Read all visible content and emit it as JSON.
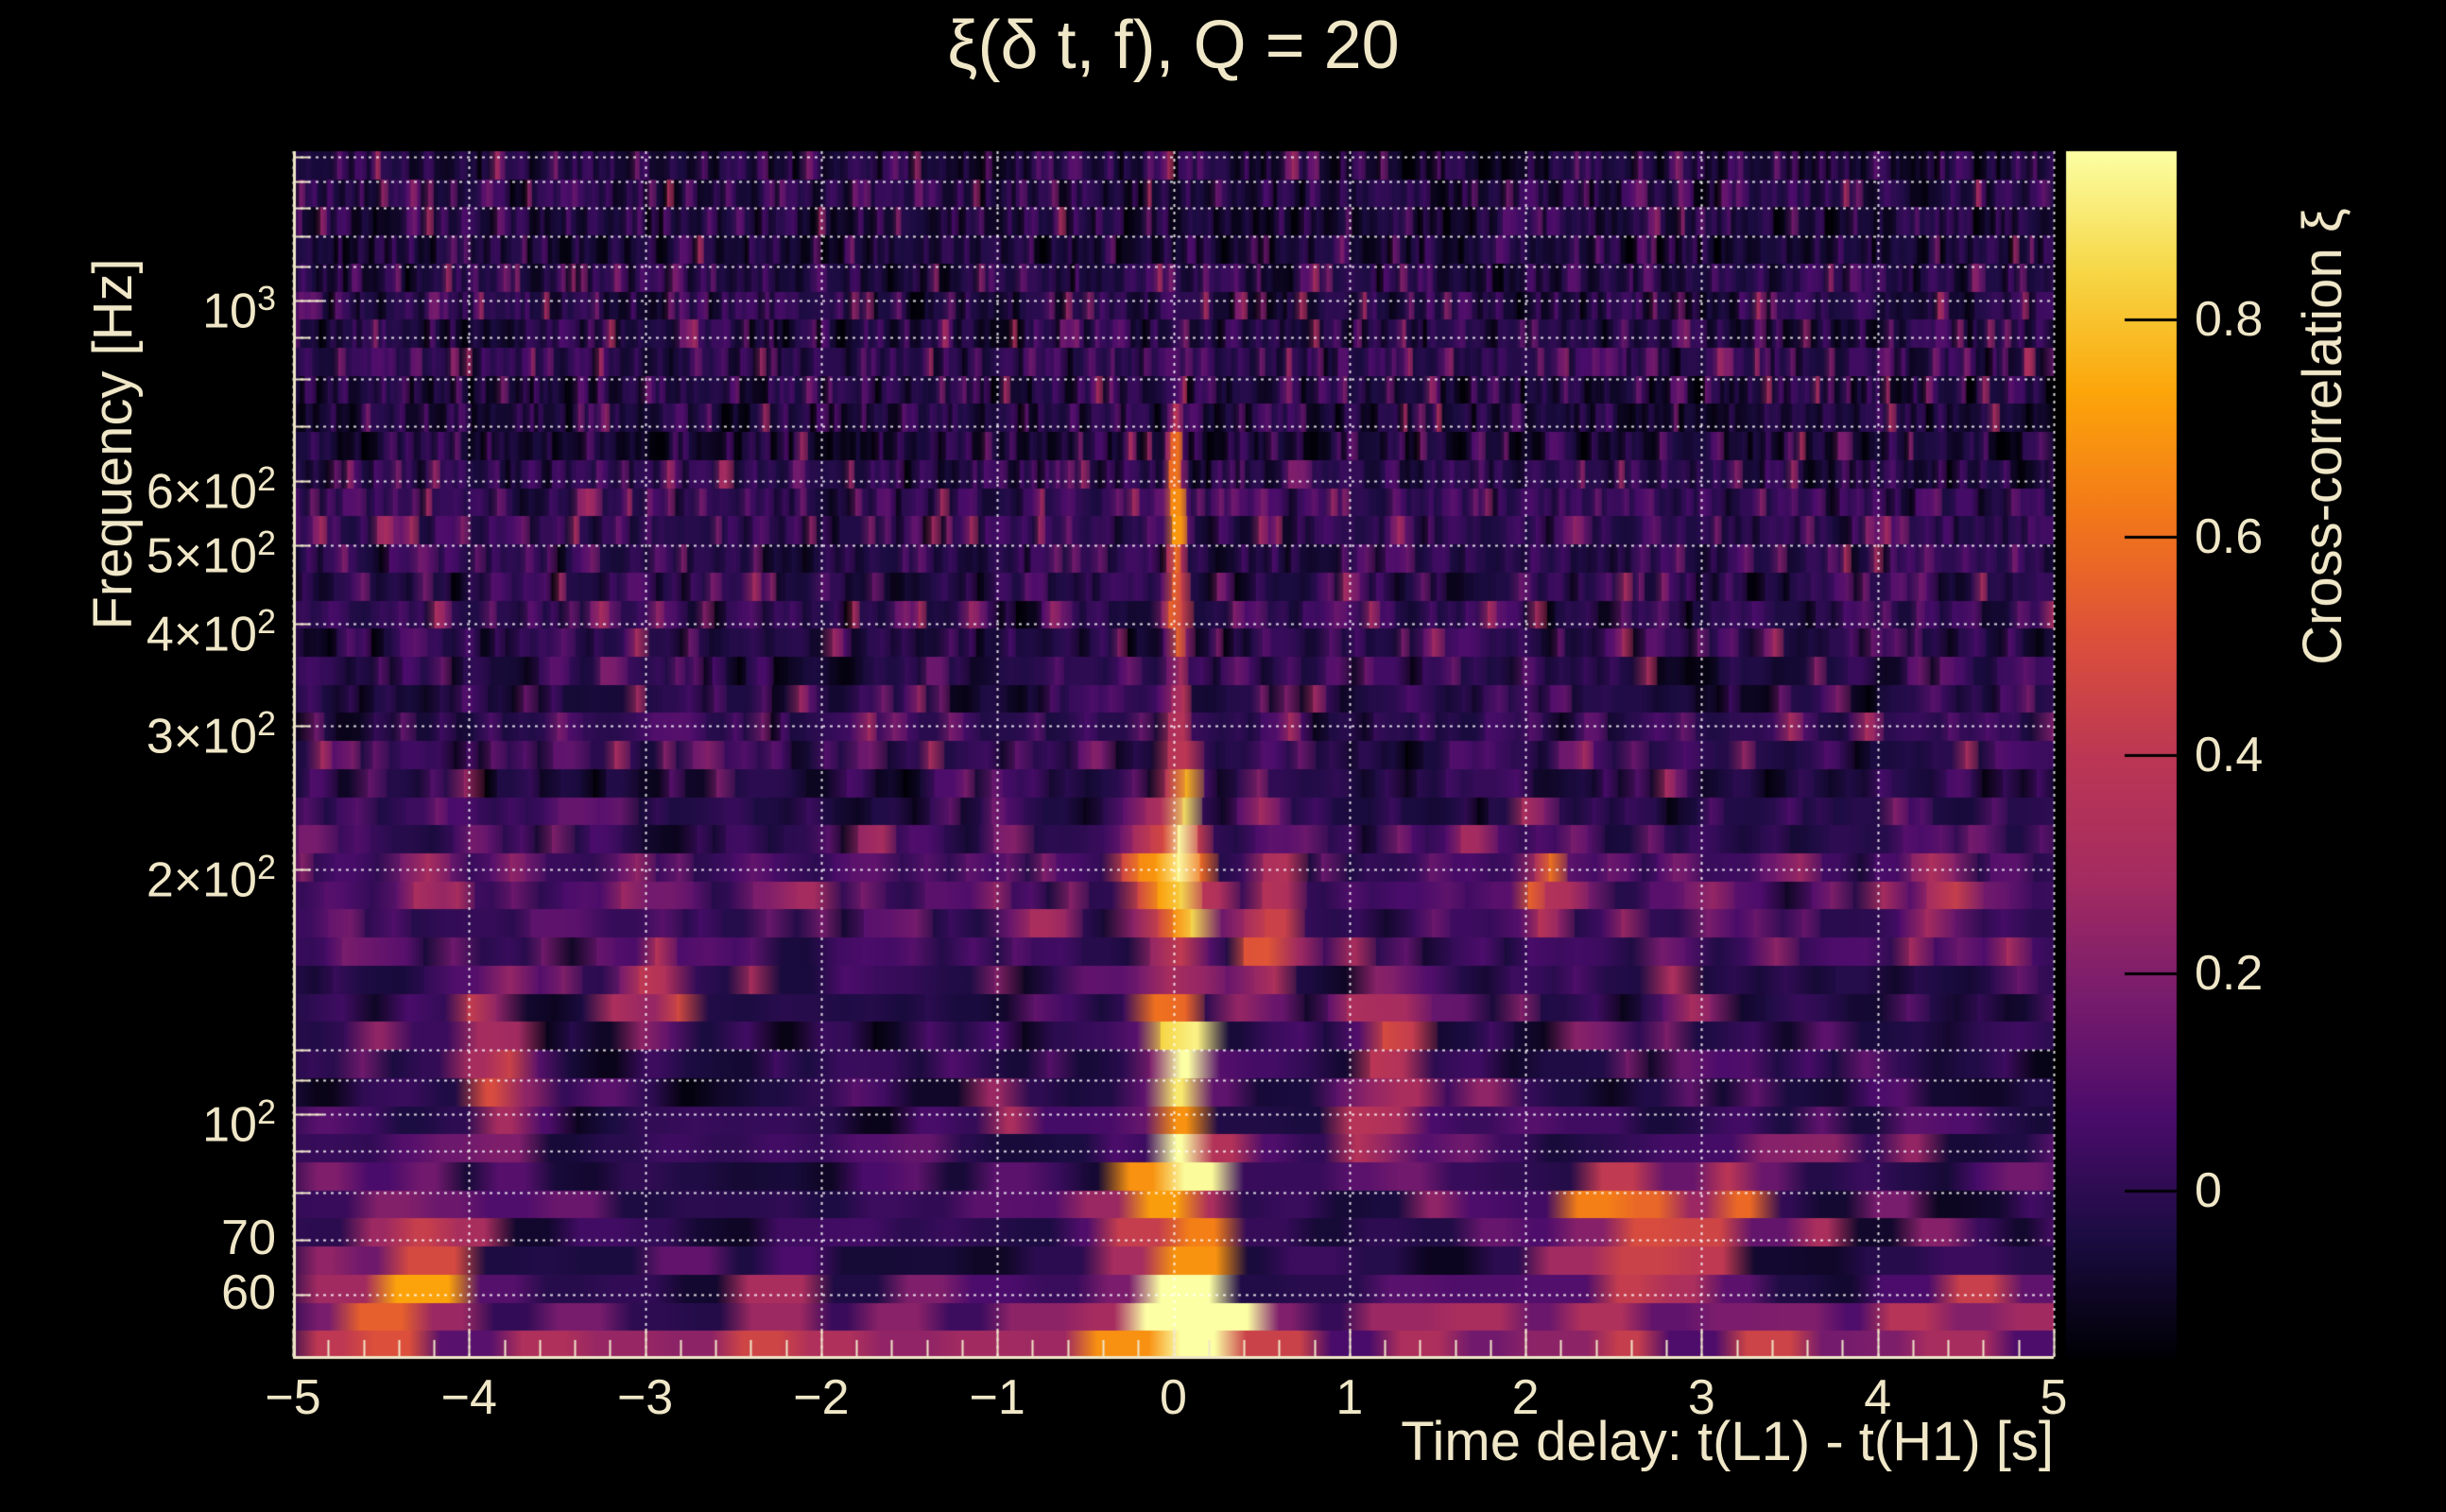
{
  "colors": {
    "background": "#000000",
    "text": "#f0e7c8",
    "grid": "#ffffff",
    "frame": "#f0e7c8",
    "colorbar_tick": "#000000"
  },
  "chart_data": {
    "type": "heatmap",
    "title": "ξ(δ t, f), Q = 20",
    "q": 20,
    "xlabel": "Time delay: t(L1) - t(H1) [s]",
    "ylabel": "Frequency [Hz]",
    "colorbar_label": "Cross-correlation ξ",
    "x_range": [
      -5,
      5
    ],
    "x_ticks": [
      {
        "v": -5,
        "label": "−5"
      },
      {
        "v": -4,
        "label": "−4"
      },
      {
        "v": -3,
        "label": "−3"
      },
      {
        "v": -2,
        "label": "−2"
      },
      {
        "v": -1,
        "label": "−1"
      },
      {
        "v": 0,
        "label": "0"
      },
      {
        "v": 1,
        "label": "1"
      },
      {
        "v": 2,
        "label": "2"
      },
      {
        "v": 3,
        "label": "3"
      },
      {
        "v": 4,
        "label": "4"
      },
      {
        "v": 5,
        "label": "5"
      }
    ],
    "x_minor_step": 0.2,
    "y_scale": "log",
    "y_range_hz": [
      50,
      1525
    ],
    "y_ticks": [
      {
        "v": 1000,
        "base": "10",
        "exp": "3"
      },
      {
        "v": 600,
        "base": "6×10",
        "exp": "2"
      },
      {
        "v": 500,
        "base": "5×10",
        "exp": "2"
      },
      {
        "v": 400,
        "base": "4×10",
        "exp": "2"
      },
      {
        "v": 300,
        "base": "3×10",
        "exp": "2"
      },
      {
        "v": 200,
        "base": "2×10",
        "exp": "2"
      },
      {
        "v": 100,
        "base": "10",
        "exp": "2"
      },
      {
        "v": 70,
        "base": "70",
        "exp": ""
      },
      {
        "v": 60,
        "base": "60",
        "exp": ""
      }
    ],
    "y_gridlines": [
      60,
      70,
      80,
      90,
      100,
      110,
      120,
      200,
      300,
      400,
      500,
      600,
      700,
      800,
      900,
      1000,
      1100,
      1200,
      1300,
      1400,
      1500
    ],
    "colorbar": {
      "min": -0.154,
      "max": 0.954,
      "ticks": [
        {
          "v": 0,
          "label": "0"
        },
        {
          "v": 0.2,
          "label": "0.2"
        },
        {
          "v": 0.4,
          "label": "0.4"
        },
        {
          "v": 0.6,
          "label": "0.6"
        },
        {
          "v": 0.8,
          "label": "0.8"
        }
      ]
    },
    "colormap": {
      "name": "inferno",
      "stops": [
        [
          0.0,
          "#000004"
        ],
        [
          0.1,
          "#1b0c41"
        ],
        [
          0.2,
          "#4a0c6b"
        ],
        [
          0.3,
          "#781c6d"
        ],
        [
          0.4,
          "#a52c60"
        ],
        [
          0.5,
          "#bc3754"
        ],
        [
          0.6,
          "#dd513a"
        ],
        [
          0.7,
          "#f37819"
        ],
        [
          0.8,
          "#fca50a"
        ],
        [
          0.9,
          "#f6d746"
        ],
        [
          1.0,
          "#fcffa4"
        ]
      ]
    },
    "features": [
      {
        "t": 0.0,
        "f": 62,
        "amp": 0.8,
        "sigma_t": 0.09,
        "sigma_logf": 0.04
      },
      {
        "t": -0.02,
        "f": 83,
        "amp": 0.88,
        "sigma_t": 0.055,
        "sigma_logf": 0.042
      },
      {
        "t": -0.01,
        "f": 110,
        "amp": 0.93,
        "sigma_t": 0.05,
        "sigma_logf": 0.045
      },
      {
        "t": 0.0,
        "f": 128,
        "amp": 0.55,
        "sigma_t": 0.05,
        "sigma_logf": 0.03
      },
      {
        "t": 0.01,
        "f": 175,
        "amp": 0.6,
        "sigma_t": 0.05,
        "sigma_logf": 0.042
      },
      {
        "t": 0.02,
        "f": 205,
        "amp": 0.5,
        "sigma_t": 0.055,
        "sigma_logf": 0.035
      },
      {
        "t": 0.02,
        "f": 240,
        "amp": 0.62,
        "sigma_t": 0.03,
        "sigma_logf": 0.05
      },
      {
        "t": 0.03,
        "f": 420,
        "amp": 0.46,
        "sigma_t": 0.022,
        "sigma_logf": 0.13
      },
      {
        "t": 0.03,
        "f": 610,
        "amp": 0.52,
        "sigma_t": 0.022,
        "sigma_logf": 0.06
      },
      {
        "t": 0.0,
        "f": 52,
        "amp": 0.42,
        "sigma_t": 0.15,
        "sigma_logf": 0.03
      },
      {
        "t": -0.2,
        "f": 200,
        "amp": 0.4,
        "sigma_t": 0.05,
        "sigma_logf": 0.04
      },
      {
        "t": -0.2,
        "f": 55,
        "amp": 0.45,
        "sigma_t": 0.08,
        "sigma_logf": 0.035
      },
      {
        "t": 0.35,
        "f": 52,
        "amp": 0.38,
        "sigma_t": 0.06,
        "sigma_logf": 0.03
      },
      {
        "t": 0.5,
        "f": 152,
        "amp": 0.34,
        "sigma_t": 0.06,
        "sigma_logf": 0.045
      },
      {
        "t": 0.55,
        "f": 195,
        "amp": 0.3,
        "sigma_t": 0.05,
        "sigma_logf": 0.04
      },
      {
        "t": -3.95,
        "f": 125,
        "amp": 0.42,
        "sigma_t": 0.06,
        "sigma_logf": 0.04
      },
      {
        "t": -3.8,
        "f": 106,
        "amp": 0.38,
        "sigma_t": 0.05,
        "sigma_logf": 0.035
      },
      {
        "t": -4.3,
        "f": 69,
        "amp": 0.4,
        "sigma_t": 0.09,
        "sigma_logf": 0.04
      },
      {
        "t": -4.55,
        "f": 59,
        "amp": 0.38,
        "sigma_t": 0.08,
        "sigma_logf": 0.035
      },
      {
        "t": -4.7,
        "f": 52,
        "amp": 0.35,
        "sigma_t": 0.06,
        "sigma_logf": 0.03
      },
      {
        "t": -3.55,
        "f": 52,
        "amp": 0.34,
        "sigma_t": 0.07,
        "sigma_logf": 0.03
      },
      {
        "t": -2.95,
        "f": 140,
        "amp": 0.28,
        "sigma_t": 0.05,
        "sigma_logf": 0.04
      },
      {
        "t": -2.25,
        "f": 54,
        "amp": 0.38,
        "sigma_t": 0.08,
        "sigma_logf": 0.03
      },
      {
        "t": -1.5,
        "f": 52,
        "amp": 0.3,
        "sigma_t": 0.06,
        "sigma_logf": 0.03
      },
      {
        "t": -0.85,
        "f": 52,
        "amp": 0.32,
        "sigma_t": 0.05,
        "sigma_logf": 0.03
      },
      {
        "t": 1.1,
        "f": 96,
        "amp": 0.36,
        "sigma_t": 0.05,
        "sigma_logf": 0.035
      },
      {
        "t": 1.2,
        "f": 125,
        "amp": 0.45,
        "sigma_t": 0.06,
        "sigma_logf": 0.045
      },
      {
        "t": 1.45,
        "f": 55,
        "amp": 0.32,
        "sigma_t": 0.06,
        "sigma_logf": 0.03
      },
      {
        "t": 2.1,
        "f": 190,
        "amp": 0.36,
        "sigma_t": 0.05,
        "sigma_logf": 0.04
      },
      {
        "t": 2.3,
        "f": 55,
        "amp": 0.4,
        "sigma_t": 0.07,
        "sigma_logf": 0.03
      },
      {
        "t": 2.55,
        "f": 75,
        "amp": 0.46,
        "sigma_t": 0.08,
        "sigma_logf": 0.04
      },
      {
        "t": 2.9,
        "f": 67,
        "amp": 0.42,
        "sigma_t": 0.08,
        "sigma_logf": 0.04
      },
      {
        "t": 3.15,
        "f": 80,
        "amp": 0.34,
        "sigma_t": 0.06,
        "sigma_logf": 0.035
      },
      {
        "t": 3.35,
        "f": 52,
        "amp": 0.34,
        "sigma_t": 0.06,
        "sigma_logf": 0.03
      },
      {
        "t": 4.15,
        "f": 56,
        "amp": 0.33,
        "sigma_t": 0.06,
        "sigma_logf": 0.03
      },
      {
        "t": 4.3,
        "f": 190,
        "amp": 0.33,
        "sigma_t": 0.05,
        "sigma_logf": 0.04
      },
      {
        "t": 4.6,
        "f": 60,
        "amp": 0.3,
        "sigma_t": 0.06,
        "sigma_logf": 0.03
      }
    ],
    "noise": {
      "seed": 77,
      "base": -0.075,
      "tail": 0.085,
      "gauss": 0.05,
      "row_jitter": 0.03,
      "bands": [
        {
          "f_lo": 50,
          "f_hi": 56,
          "boost": 0.09
        },
        {
          "f_lo": 56,
          "f_hi": 100,
          "boost": 0.025
        },
        {
          "f_lo": 140,
          "f_hi": 215,
          "boost": 0.045
        }
      ]
    }
  }
}
